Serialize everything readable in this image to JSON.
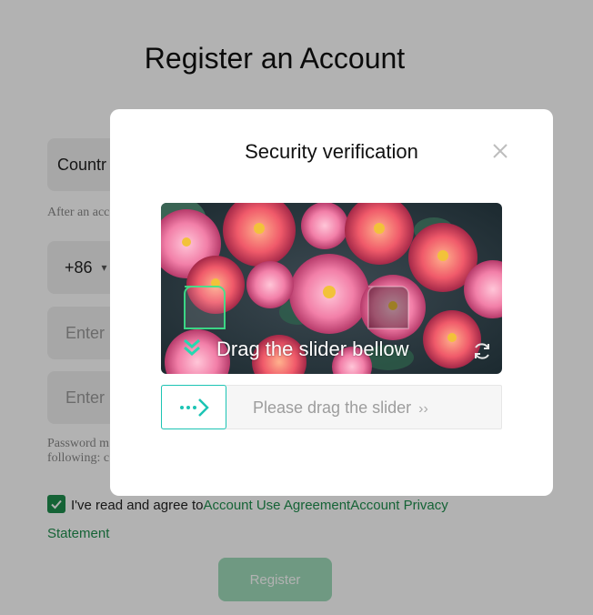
{
  "background": {
    "title": "Register an Account",
    "country_field": "Countr",
    "country_hint": "After an acc",
    "phone_prefix": "+86",
    "code_placeholder": "Enter",
    "password_placeholder": "Enter",
    "password_hint_1": "Password m",
    "password_hint_2": "following: c",
    "agree_text": "I've read and agree to",
    "agreement_link": "Account Use Agreement",
    "privacy_link_1": "Account Privacy",
    "privacy_link_2": "Statement",
    "register_button": "Register"
  },
  "modal": {
    "title": "Security verification",
    "puzzle_instruction": "Drag the slider bellow",
    "slider_placeholder": "Please drag the slider",
    "slider_arrows": "››",
    "icons": [
      "close-icon",
      "double-chevron-down-icon",
      "refresh-icon",
      "dotted-arrow-right-icon"
    ]
  },
  "colors": {
    "accent_teal": "#1cc4b4",
    "brand_green": "#1f8f4e",
    "register_disabled": "#9fdcba"
  }
}
